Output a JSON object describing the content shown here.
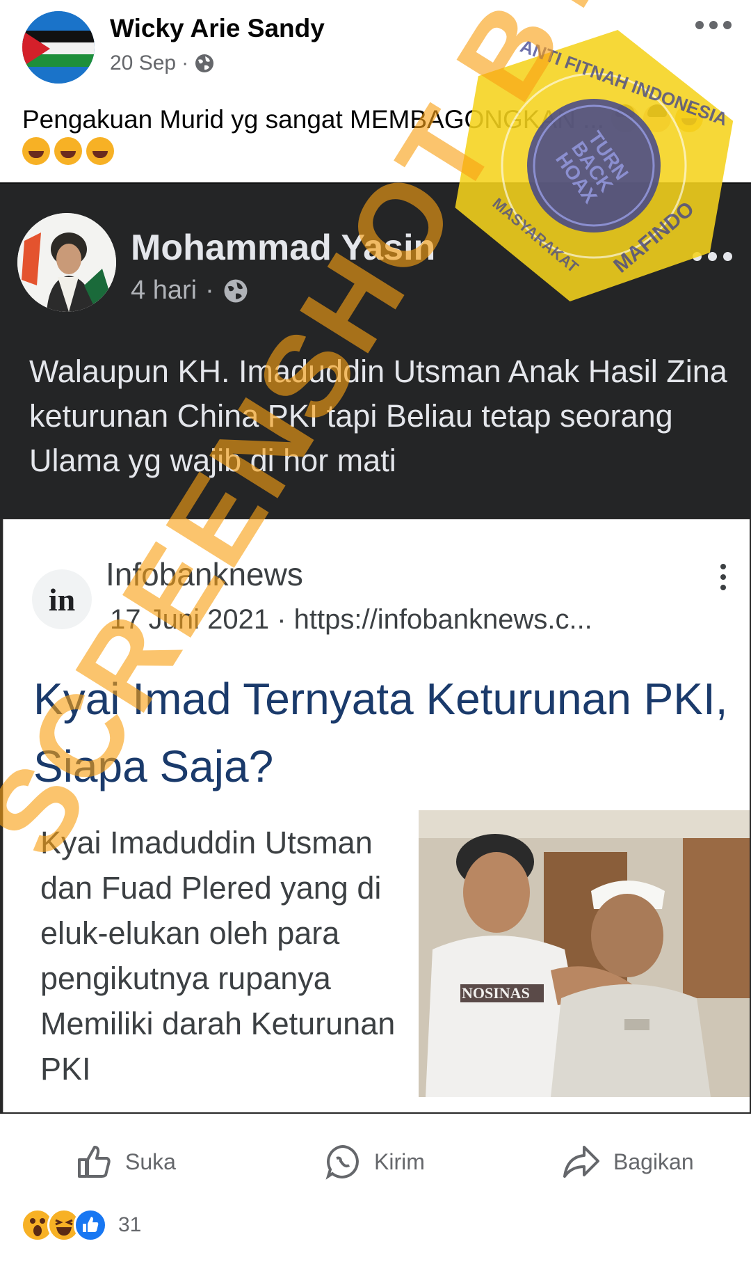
{
  "post": {
    "author": "Wicky Arie Sandy",
    "date": "20 Sep",
    "separator": "·",
    "caption": "Pengakuan Murid yg sangat MEMBAGONGKAN ..."
  },
  "shared_post": {
    "author": "Mohammad Yasin",
    "date": "4 hari",
    "separator": "·",
    "text": "Walaupun KH. Imaduddin Utsman  Anak Hasil Zina keturunan China PKI tapi Beliau tetap seorang Ulama yg wajib di hor mati"
  },
  "news_card": {
    "logo_text": "in",
    "source": "Infobanknews",
    "date": "17 Juni 2021",
    "separator": "·",
    "url": "https://infobanknews.c...",
    "headline": "Kyai Imad Ternyata Keturunan PKI, Siapa Saja?",
    "body": "Kyai Imaduddin Utsman dan Fuad Plered yang di eluk-elukan oleh para pengikutnya rupanya Memiliki darah Keturunan PKI",
    "shirt_text": "NOSINAS"
  },
  "actions": {
    "like": "Suka",
    "send": "Kirim",
    "share": "Bagikan"
  },
  "reactions": {
    "types": [
      "wow",
      "haha",
      "like"
    ],
    "count": "31"
  },
  "watermark": {
    "text": "SCREENSHOT BY",
    "seal_top": "ANTI FITNAH INDONESIA",
    "seal_center": "TURN BACK HOAX",
    "seal_left": "MASYARAKAT",
    "seal_right": "MAFINDO"
  },
  "icons": [
    "palestine-flag-avatar",
    "globe-icon",
    "more-icon",
    "kebab-icon",
    "like-icon",
    "messenger-icon",
    "share-icon"
  ],
  "colors": {
    "dark_bg": "#242526",
    "headline": "#1a3a6b",
    "secondary_text": "#65676b",
    "watermark": "#f8a014",
    "seal": "#f5d31c",
    "seal_inner": "#3b3f8f"
  }
}
